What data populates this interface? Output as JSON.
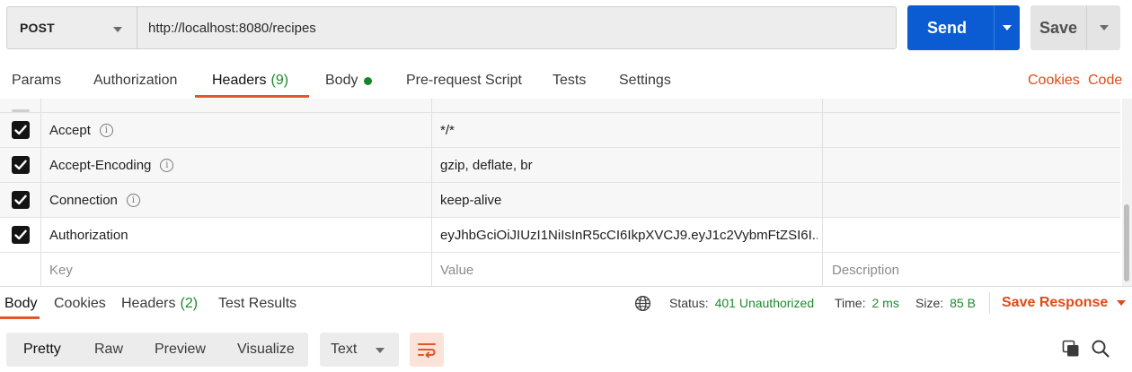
{
  "request": {
    "method": "POST",
    "url": "http://localhost:8080/recipes",
    "send_label": "Send",
    "save_label": "Save"
  },
  "tabs": {
    "params": "Params",
    "authorization": "Authorization",
    "headers": "Headers",
    "headers_count": "(9)",
    "body": "Body",
    "prerequest": "Pre-request Script",
    "tests": "Tests",
    "settings": "Settings",
    "cookies": "Cookies",
    "code": "Code"
  },
  "headers_table": {
    "rows": [
      {
        "key": "Accept",
        "value": "*/*",
        "checked": true,
        "info": true
      },
      {
        "key": "Accept-Encoding",
        "value": "gzip, deflate, br",
        "checked": true,
        "info": true
      },
      {
        "key": "Connection",
        "value": "keep-alive",
        "checked": true,
        "info": true
      },
      {
        "key": "Authorization",
        "value": "eyJhbGciOiJIUzI1NiIsInR5cCI6IkpXVCJ9.eyJ1c2VybmFtZSI6I...",
        "checked": true,
        "info": false
      }
    ],
    "placeholders": {
      "key": "Key",
      "value": "Value",
      "description": "Description"
    }
  },
  "response": {
    "tabs": {
      "body": "Body",
      "cookies": "Cookies",
      "headers": "Headers",
      "headers_count": "(2)",
      "test_results": "Test Results"
    },
    "status_label": "Status:",
    "status_value": "401 Unauthorized",
    "time_label": "Time:",
    "time_value": "2 ms",
    "size_label": "Size:",
    "size_value": "85 B",
    "save_response": "Save Response",
    "views": {
      "pretty": "Pretty",
      "raw": "Raw",
      "preview": "Preview",
      "visualize": "Visualize"
    },
    "format": "Text"
  },
  "icons": {
    "globe": "globe-icon",
    "wrap": "wrap-lines-icon",
    "copy": "copy-icon",
    "search": "search-icon",
    "info": "info-icon"
  },
  "colors": {
    "accent": "#e2562a",
    "send": "#0b5bd3",
    "success": "#1d8a2a",
    "link": "#e14a18"
  }
}
